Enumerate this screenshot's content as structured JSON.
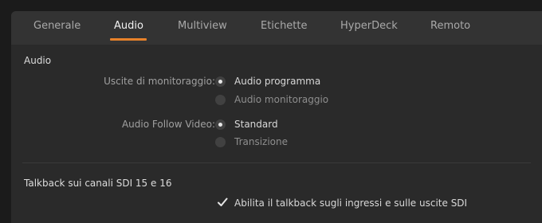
{
  "tabs": [
    {
      "label": "Generale"
    },
    {
      "label": "Audio"
    },
    {
      "label": "Multiview"
    },
    {
      "label": "Etichette"
    },
    {
      "label": "HyperDeck"
    },
    {
      "label": "Remoto"
    }
  ],
  "active_tab": "Audio",
  "audio_section": {
    "title": "Audio",
    "monitor_outputs": {
      "label": "Uscite di monitoraggio:",
      "options": [
        "Audio programma",
        "Audio monitoraggio"
      ],
      "selected": "Audio programma"
    },
    "follow_video": {
      "label": "Audio Follow Video:",
      "options": [
        "Standard",
        "Transizione"
      ],
      "selected": "Standard"
    }
  },
  "talkback_section": {
    "title": "Talkback sui canali SDI 15 e 16",
    "checkbox_label": "Abilita il talkback sugli ingressi e sulle uscite SDI",
    "checked": true
  },
  "colors": {
    "accent": "#e8822a",
    "panel_bg": "#2a2a2a",
    "tabbar_bg": "#333333"
  }
}
